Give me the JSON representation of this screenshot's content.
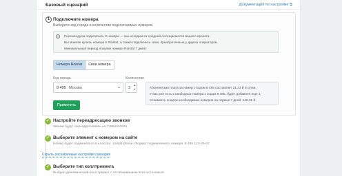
{
  "header": {
    "title": "Базовый сценарий",
    "doc_link": "Документация по настройке"
  },
  "step1": {
    "number": "1",
    "title": "Подключите номера",
    "subtitle": "Выберите код города и количество подключаемых номеров.",
    "notice_lines": [
      "Рекомендуем подключить 3 номера — мы исходим из средней посещаемости вашего проекта.",
      "Вы можете купить номера в Roistat, а также подключить свои, приобретенные у других операторов.",
      "Минимальный период покупки номера Roistat 7 дней."
    ],
    "tabs": [
      "Номера Roistat",
      "Свои номера"
    ],
    "city_label": "Код города",
    "city_code": "8 495",
    "city_name": "Москва",
    "qty_label": "Количество",
    "qty_value": "3",
    "tariff_lines": [
      "Абонентская плата за номер с кодом 8 495 составляет 21,33 ₽ в сутки.",
      "У вас уже есть 2 свободных номера с кодом 8 495, будет добавлен еще 1.",
      "Стоимость покупки необходимых номеров на первые 7 дней: 149,31 ₽."
    ],
    "apply_button": "Применить"
  },
  "steps": [
    {
      "title": "Настройте переадресацию звонков",
      "subtitle": "Звонки будут переадресованы на 74952223041"
    },
    {
      "title": "Выберите элемент с номером на сайте",
      "subtitle": "Номер будет подменяться в классах: .roistat-phone. Формат подменяемого номера: 8 495 123-45-67"
    },
    {
      "title": "Выберите тип коллтрекинга",
      "subtitle": "Выбран динамический колл трекинг с отслеживанием всех источников"
    }
  ],
  "advanced_link": "Скрыть расширенные настройки сценария",
  "colors": {
    "accent": "#2a7ab8",
    "success": "#21a05c",
    "check": "#8bbb3c",
    "tab_active": "#c6dcf0"
  }
}
